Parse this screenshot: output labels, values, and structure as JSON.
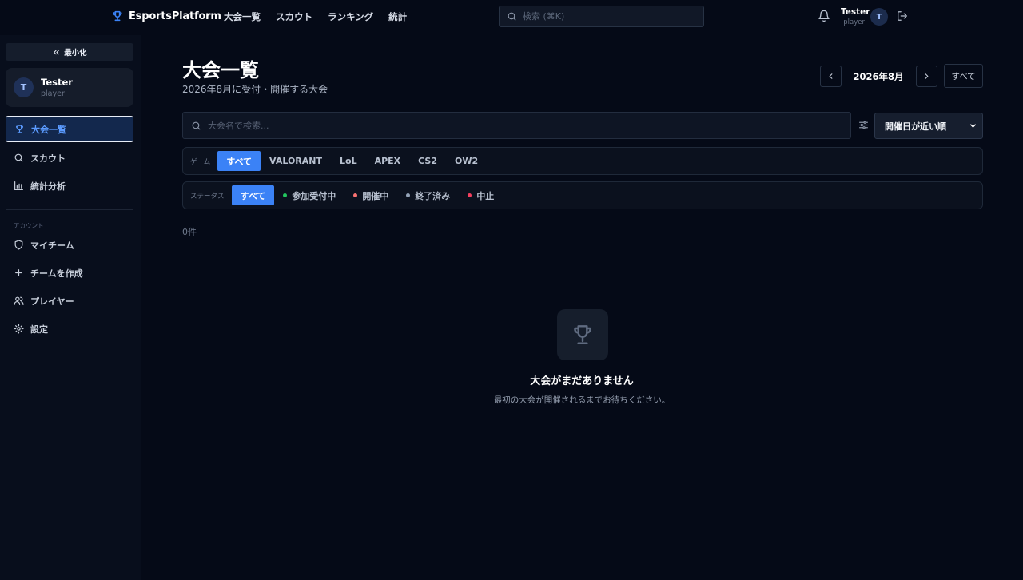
{
  "header": {
    "brand": "EsportsPlatform",
    "nav": [
      "大会一覧",
      "スカウト",
      "ランキング",
      "統計"
    ],
    "search_placeholder": "検索 (⌘K)",
    "user": {
      "name": "Tester",
      "role": "player",
      "avatar_initial": "T"
    }
  },
  "sidebar": {
    "minimize_label": "最小化",
    "profile": {
      "name": "Tester",
      "role": "player",
      "avatar_initial": "T"
    },
    "main_items": [
      {
        "label": "大会一覧",
        "icon": "trophy-icon",
        "active": true
      },
      {
        "label": "スカウト",
        "icon": "search-icon",
        "active": false
      },
      {
        "label": "統計分析",
        "icon": "bar-chart-icon",
        "active": false
      }
    ],
    "section_label": "アカウント",
    "account_items": [
      {
        "label": "マイチーム",
        "icon": "shield-icon"
      },
      {
        "label": "チームを作成",
        "icon": "plus-icon"
      },
      {
        "label": "プレイヤー",
        "icon": "users-icon"
      },
      {
        "label": "設定",
        "icon": "gear-icon"
      }
    ]
  },
  "main": {
    "title": "大会一覧",
    "subtitle": "2026年8月に受付・開催する大会",
    "month_label": "2026年8月",
    "all_button": "すべて",
    "search_placeholder": "大会名で検索...",
    "sort_value": "開催日が近い順",
    "game_filter": {
      "label": "ゲーム",
      "options": [
        "すべて",
        "VALORANT",
        "LoL",
        "APEX",
        "CS2",
        "OW2"
      ],
      "selected": "すべて"
    },
    "status_filter": {
      "label": "ステータス",
      "options": [
        {
          "label": "すべて",
          "dot_color": null
        },
        {
          "label": "参加受付中",
          "dot_color": "#22c55e"
        },
        {
          "label": "開催中",
          "dot_color": "#f87171"
        },
        {
          "label": "終了済み",
          "dot_color": "#94a3b8"
        },
        {
          "label": "中止",
          "dot_color": "#f43f5e"
        }
      ],
      "selected": "すべて"
    },
    "count_text": "0件",
    "empty": {
      "title": "大会がまだありません",
      "description": "最初の大会が開催されるまでお待ちください。"
    }
  },
  "colors": {
    "accent": "#3b82f6",
    "background": "#050a17",
    "sidebar": "#080e1c"
  }
}
